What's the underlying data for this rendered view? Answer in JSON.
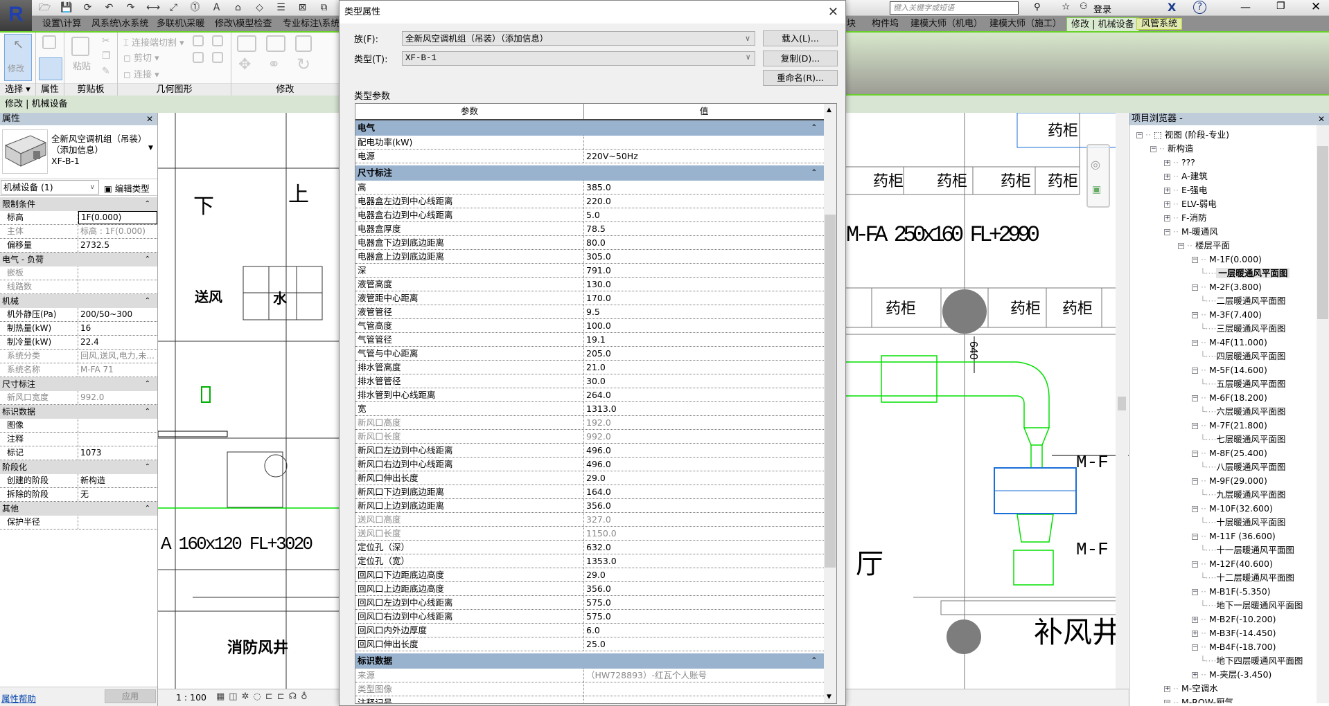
{
  "app": {
    "logo": "R",
    "search_placeholder": "键入关键字或短语",
    "login": "登录"
  },
  "quick_access_icons": [
    "open-icon",
    "save-icon",
    "sync-icon",
    "undo-icon",
    "redo-icon",
    "measure-icon",
    "dimension-icon",
    "tag-icon",
    "text-icon",
    "3d-view-icon",
    "section-icon",
    "thin-lines-icon",
    "close-hidden-icon",
    "switch-windows-icon"
  ],
  "tabs": [
    "设置\\计算",
    "风系统\\水系统",
    "多联机\\采暖",
    "修改\\模型检查",
    "专业标注\\系统图",
    "块",
    "构件坞",
    "建模大师（机电）",
    "建模大师（施工）",
    "修改 | 机械设备",
    "风管系统"
  ],
  "ribbon": {
    "panels": [
      "选择",
      "属性",
      "剪贴板",
      "几何图形",
      "修改"
    ],
    "modify_label": "修改",
    "paste_label": "粘贴",
    "cope_label": "连接端切割",
    "cut_label": "剪切",
    "join_label": "连接"
  },
  "context_bar": "修改 | 机械设备",
  "properties": {
    "title": "属性",
    "type_name": "全新风空调机组（吊装）（添加信息）",
    "type_sub": "XF-B-1",
    "selector": "机械设备 (1)",
    "edit_type": "编辑类型",
    "groups": [
      {
        "name": "限制条件",
        "rows": [
          {
            "l": "标高",
            "v": "1F(0.000)",
            "edit": true
          },
          {
            "l": "主体",
            "v": "标高 : 1F(0.000)",
            "grey": true
          },
          {
            "l": "偏移量",
            "v": "2732.5"
          }
        ]
      },
      {
        "name": "电气 - 负荷",
        "rows": [
          {
            "l": "嵌板",
            "v": "",
            "grey": true
          },
          {
            "l": "线路数",
            "v": "",
            "grey": true
          }
        ]
      },
      {
        "name": "机械",
        "rows": [
          {
            "l": "机外静压(Pa)",
            "v": "200/50~300"
          },
          {
            "l": "制热量(kW)",
            "v": "16"
          },
          {
            "l": "制冷量(kW)",
            "v": "22.4"
          },
          {
            "l": "系统分类",
            "v": "回风,送风,电力,未...",
            "grey": true
          },
          {
            "l": "系统名称",
            "v": "M-FA 71",
            "grey": true
          }
        ]
      },
      {
        "name": "尺寸标注",
        "rows": [
          {
            "l": "新风口宽度",
            "v": "992.0",
            "grey": true
          }
        ]
      },
      {
        "name": "标识数据",
        "rows": [
          {
            "l": "图像",
            "v": ""
          },
          {
            "l": "注释",
            "v": ""
          },
          {
            "l": "标记",
            "v": "1073"
          }
        ]
      },
      {
        "name": "阶段化",
        "rows": [
          {
            "l": "创建的阶段",
            "v": "新构造"
          },
          {
            "l": "拆除的阶段",
            "v": "无"
          }
        ]
      },
      {
        "name": "其他",
        "rows": [
          {
            "l": "保护半径",
            "v": ""
          }
        ]
      }
    ],
    "help": "属性帮助",
    "apply": "应用"
  },
  "dialog": {
    "title": "类型属性",
    "family_label": "族(F):",
    "family_value": "全新风空调机组（吊装）（添加信息）",
    "type_label": "类型(T):",
    "type_value": "XF-B-1",
    "load": "载入(L)...",
    "duplicate": "复制(D)...",
    "rename": "重命名(R)...",
    "params_label": "类型参数",
    "col_param": "参数",
    "col_value": "值",
    "groups": [
      {
        "name": "电气",
        "rows": [
          {
            "l": "配电功率(kW)",
            "v": ""
          },
          {
            "l": "电源",
            "v": "220V~50Hz"
          }
        ]
      },
      {
        "name": "尺寸标注",
        "rows": [
          {
            "l": "高",
            "v": "385.0"
          },
          {
            "l": "电器盒左边到中心线距离",
            "v": "220.0"
          },
          {
            "l": "电器盒右边到中心线距离",
            "v": "5.0"
          },
          {
            "l": "电器盒厚度",
            "v": "78.5"
          },
          {
            "l": "电器盒下边到底边距离",
            "v": "80.0"
          },
          {
            "l": "电器盒上边到底边距离",
            "v": "305.0"
          },
          {
            "l": "深",
            "v": "791.0"
          },
          {
            "l": "液管高度",
            "v": "130.0"
          },
          {
            "l": "液管距中心距离",
            "v": "170.0"
          },
          {
            "l": "液管管径",
            "v": "9.5"
          },
          {
            "l": "气管高度",
            "v": "100.0"
          },
          {
            "l": "气管管径",
            "v": "19.1"
          },
          {
            "l": "气管与中心距离",
            "v": "205.0"
          },
          {
            "l": "排水管高度",
            "v": "21.0"
          },
          {
            "l": "排水管管径",
            "v": "30.0"
          },
          {
            "l": "排水管到中心线距离",
            "v": "264.0"
          },
          {
            "l": "宽",
            "v": "1313.0"
          },
          {
            "l": "新风口高度",
            "v": "192.0",
            "grey": true
          },
          {
            "l": "新风口长度",
            "v": "992.0",
            "grey": true
          },
          {
            "l": "新风口左边到中心线距离",
            "v": "496.0"
          },
          {
            "l": "新风口右边到中心线距离",
            "v": "496.0"
          },
          {
            "l": "新风口伸出长度",
            "v": "29.0"
          },
          {
            "l": "新风口下边到底边距离",
            "v": "164.0"
          },
          {
            "l": "新风口上边到底边距离",
            "v": "356.0"
          },
          {
            "l": "送风口高度",
            "v": "327.0",
            "grey": true
          },
          {
            "l": "送风口长度",
            "v": "1150.0",
            "grey": true
          },
          {
            "l": "定位孔（深）",
            "v": "632.0"
          },
          {
            "l": "定位孔（宽）",
            "v": "1353.0"
          },
          {
            "l": "回风口下边距底边高度",
            "v": "29.0"
          },
          {
            "l": "回风口上边距底边高度",
            "v": "356.0"
          },
          {
            "l": "回风口左边到中心线距离",
            "v": "575.0"
          },
          {
            "l": "回风口右边到中心线距离",
            "v": "575.0"
          },
          {
            "l": "回风口内外边厚度",
            "v": "6.0"
          },
          {
            "l": "回风口伸出长度",
            "v": "25.0"
          }
        ]
      },
      {
        "name": "标识数据",
        "rows": [
          {
            "l": "来源",
            "v": "（HW728893）-红瓦个人账号",
            "grey": true
          },
          {
            "l": "类型图像",
            "v": "",
            "grey": true
          },
          {
            "l": "注释记号",
            "v": ""
          }
        ]
      }
    ]
  },
  "browser": {
    "title": "项目浏览器 -",
    "items": [
      {
        "lv": 0,
        "e": "-",
        "t": "视图 (阶段-专业)"
      },
      {
        "lv": 1,
        "e": "-",
        "t": "新构造"
      },
      {
        "lv": 2,
        "e": "+",
        "t": "???"
      },
      {
        "lv": 2,
        "e": "+",
        "t": "A-建筑"
      },
      {
        "lv": 2,
        "e": "+",
        "t": "E-强电"
      },
      {
        "lv": 2,
        "e": "+",
        "t": "ELV-弱电"
      },
      {
        "lv": 2,
        "e": "+",
        "t": "F-消防"
      },
      {
        "lv": 2,
        "e": "-",
        "t": "M-暖通风"
      },
      {
        "lv": 3,
        "e": "-",
        "t": "楼层平面"
      },
      {
        "lv": 4,
        "e": "-",
        "t": "M-1F(0.000)"
      },
      {
        "lv": 5,
        "e": "",
        "t": "一层暖通风平面图",
        "sel": true
      },
      {
        "lv": 4,
        "e": "-",
        "t": "M-2F(3.800)"
      },
      {
        "lv": 5,
        "e": "",
        "t": "二层暖通风平面图"
      },
      {
        "lv": 4,
        "e": "-",
        "t": "M-3F(7.400)"
      },
      {
        "lv": 5,
        "e": "",
        "t": "三层暖通风平面图"
      },
      {
        "lv": 4,
        "e": "-",
        "t": "M-4F(11.000)"
      },
      {
        "lv": 5,
        "e": "",
        "t": "四层暖通风平面图"
      },
      {
        "lv": 4,
        "e": "-",
        "t": "M-5F(14.600)"
      },
      {
        "lv": 5,
        "e": "",
        "t": "五层暖通风平面图"
      },
      {
        "lv": 4,
        "e": "-",
        "t": "M-6F(18.200)"
      },
      {
        "lv": 5,
        "e": "",
        "t": "六层暖通风平面图"
      },
      {
        "lv": 4,
        "e": "-",
        "t": "M-7F(21.800)"
      },
      {
        "lv": 5,
        "e": "",
        "t": "七层暖通风平面图"
      },
      {
        "lv": 4,
        "e": "-",
        "t": "M-8F(25.400)"
      },
      {
        "lv": 5,
        "e": "",
        "t": "八层暖通风平面图"
      },
      {
        "lv": 4,
        "e": "-",
        "t": "M-9F(29.000)"
      },
      {
        "lv": 5,
        "e": "",
        "t": "九层暖通风平面图"
      },
      {
        "lv": 4,
        "e": "-",
        "t": "M-10F(32.600)"
      },
      {
        "lv": 5,
        "e": "",
        "t": "十层暖通风平面图"
      },
      {
        "lv": 4,
        "e": "-",
        "t": "M-11F (36.600)"
      },
      {
        "lv": 5,
        "e": "",
        "t": "十一层暖通风平面图"
      },
      {
        "lv": 4,
        "e": "-",
        "t": "M-12F(40.600)"
      },
      {
        "lv": 5,
        "e": "",
        "t": "十二层暖通风平面图"
      },
      {
        "lv": 4,
        "e": "-",
        "t": "M-B1F(-5.350)"
      },
      {
        "lv": 5,
        "e": "",
        "t": "地下一层暖通风平面图"
      },
      {
        "lv": 4,
        "e": "+",
        "t": "M-B2F(-10.200)"
      },
      {
        "lv": 4,
        "e": "+",
        "t": "M-B3F(-14.450)"
      },
      {
        "lv": 4,
        "e": "-",
        "t": "M-B4F(-18.700)"
      },
      {
        "lv": 5,
        "e": "",
        "t": "地下四层暖通风平面图"
      },
      {
        "lv": 4,
        "e": "+",
        "t": "M-夹层(-3.450)"
      },
      {
        "lv": 2,
        "e": "+",
        "t": "M-空调水"
      },
      {
        "lv": 2,
        "e": "-",
        "t": "M-ROW-厨气"
      }
    ]
  },
  "drawing": {
    "left_labels": {
      "down": "下",
      "up": "上",
      "supply": "送风",
      "water": "水",
      "shaft": "消防风井",
      "duct_tag": "A 160x120 FL+3020"
    },
    "right_labels": {
      "cabinet": "药柜",
      "duct_tag": "M-FA 250x160 FL+2990",
      "dim": "640",
      "tag1": "M-F",
      "tag2": "M-F",
      "fresh_shaft": "补风井",
      "hall": "厅"
    },
    "duct_color": "#00e000",
    "selection_color": "#1a6ed8"
  },
  "status": {
    "scale": "1 : 100"
  }
}
